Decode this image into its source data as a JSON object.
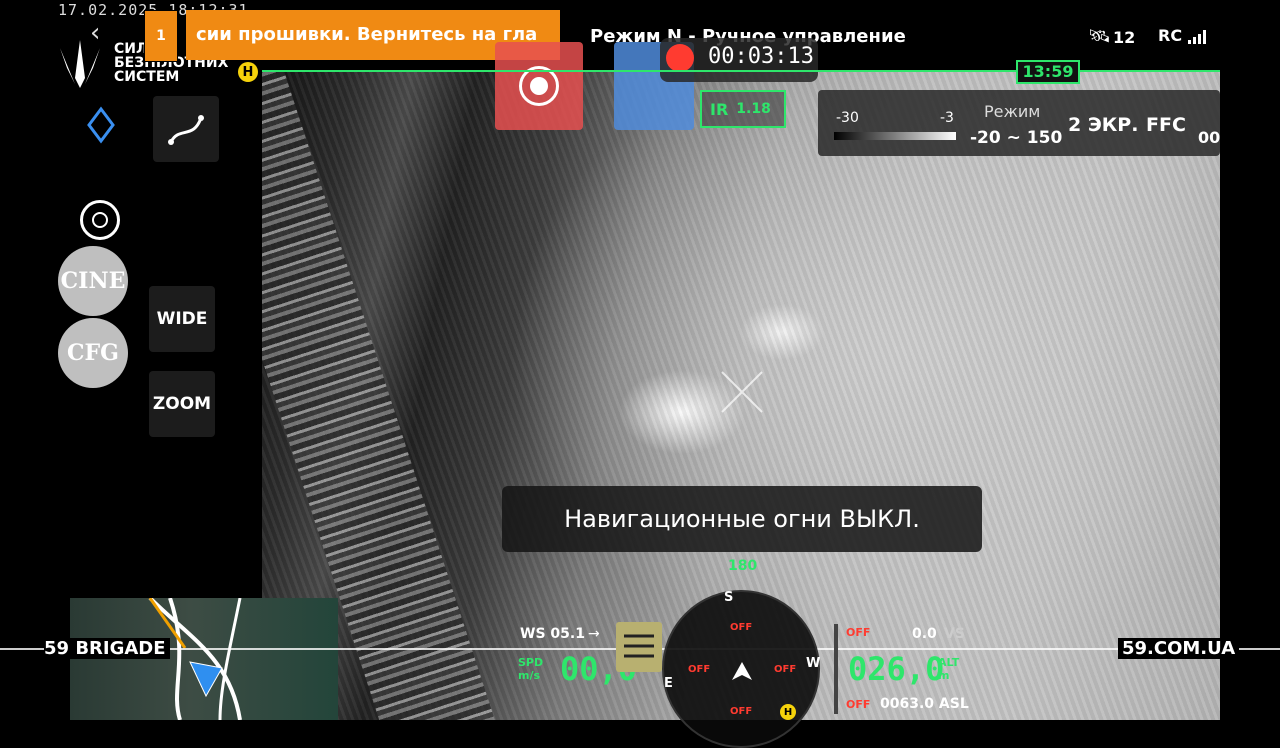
{
  "watermark": {
    "datetime": "17.02.2025 18:12:31",
    "org_line1": "СИЛИ",
    "org_line2": "БЕЗПІЛОТНИХ",
    "org_line3": "СИСТЕМ",
    "brigade": "59 BRIGADE",
    "site": "59.COM.UA"
  },
  "banner": {
    "badge": "1",
    "text": "сии прошивки. Вернитесь на гла"
  },
  "header": {
    "mode_title": "Режим N - Ручное управление",
    "rec_time": "00:03:13",
    "satellites": "12",
    "rc_label": "RC",
    "flight_time": "13:59"
  },
  "tabs": {
    "ir": "IR",
    "ir_value": "1.18"
  },
  "thermal": {
    "scale_min": "-30",
    "scale_max": "-3",
    "mode_label": "Режим",
    "mode_range": "-20 ~ 150",
    "screen": "2 ЭКР.",
    "ffc": "FFC",
    "cut": "00"
  },
  "left": {
    "cine": "CINE",
    "cfg": "CFG",
    "wide": "WIDE",
    "zoom": "ZOOM"
  },
  "toast": "Навигационные огни ВЫКЛ.",
  "telemetry": {
    "ws": "WS 05.1",
    "ws_arrow": "→",
    "spd_label": "SPD",
    "spd_unit": "m/s",
    "spd_value": "00,0",
    "heading": "180",
    "vs_value": "0.0",
    "vs_label": "VS",
    "alt_value": "026,0",
    "alt_label": "ALT",
    "alt_unit": "m",
    "asl": "0063.0 ASL",
    "off": "OFF",
    "compass_s": "S",
    "compass_w": "W",
    "compass_e": "E",
    "home": "H"
  },
  "colors": {
    "accent": "#2ee66b",
    "banner": "#f08a13",
    "record": "#ff3b30"
  }
}
